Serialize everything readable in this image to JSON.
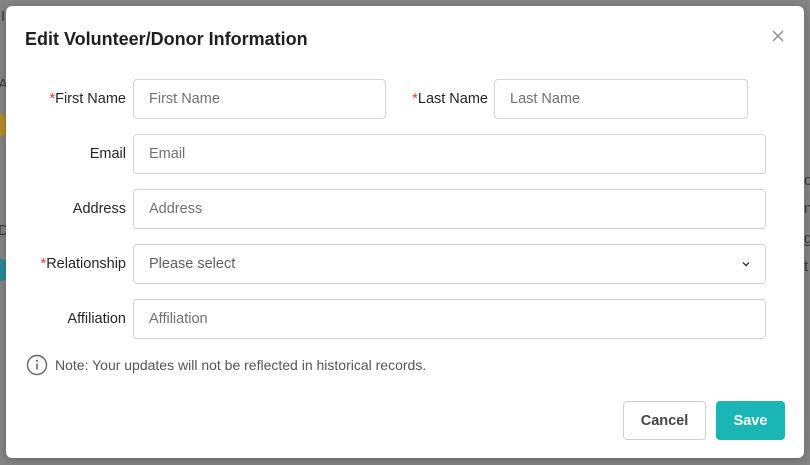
{
  "colors": {
    "accent": "#1ab5b5",
    "required": "#e53935",
    "backdrop_dot_1": "#b58a2a",
    "backdrop_dot_2": "#2a8a9a"
  },
  "modal": {
    "title": "Edit Volunteer/Donor Information",
    "close_icon": "close-icon"
  },
  "form": {
    "first_name": {
      "required_mark": "*",
      "label": "First Name",
      "placeholder": "First Name",
      "value": ""
    },
    "last_name": {
      "required_mark": "*",
      "label": "Last Name",
      "placeholder": "Last Name",
      "value": ""
    },
    "email": {
      "label": "Email",
      "placeholder": "Email",
      "value": ""
    },
    "address": {
      "label": "Address",
      "placeholder": "Address",
      "value": ""
    },
    "relationship": {
      "required_mark": "*",
      "label": "Relationship",
      "selected": "Please select",
      "icon": "chevron-down-icon"
    },
    "affiliation": {
      "label": "Affiliation",
      "placeholder": "Affiliation",
      "value": ""
    }
  },
  "note": {
    "icon": "info-icon",
    "text": "Note: Your updates will not be reflected in historical records."
  },
  "footer": {
    "cancel_label": "Cancel",
    "save_label": "Save"
  }
}
